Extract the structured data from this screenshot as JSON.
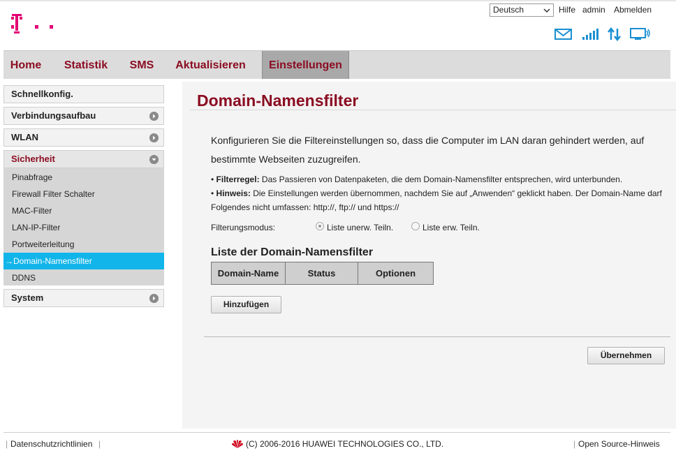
{
  "header": {
    "language": "Deutsch",
    "links": [
      "Hilfe",
      "admin",
      "Abmelden"
    ],
    "icons": [
      "mail-icon",
      "signal-icon",
      "data-transfer-icon",
      "monitor-icon"
    ],
    "brand_color": "#e20074"
  },
  "nav": {
    "tabs": [
      "Home",
      "Statistik",
      "SMS",
      "Aktualisieren",
      "Einstellungen"
    ],
    "active": "Einstellungen"
  },
  "sidebar": {
    "sections": [
      "Schnellkonfig.",
      "Verbindungsaufbau",
      "WLAN",
      "Sicherheit",
      "System"
    ],
    "open_section": "Sicherheit",
    "sub_items": [
      "Pinabfrage",
      "Firewall Filter Schalter",
      "MAC-Filter",
      "LAN-IP-Filter",
      "Portweiterleitung",
      "Domain-Namensfilter",
      "DDNS"
    ],
    "active_item": "Domain-Namensfilter",
    "active_prefix": "→"
  },
  "main": {
    "title": "Domain-Namensfilter",
    "intro": "Konfigurieren Sie die Filtereinstellungen so, dass die Computer im LAN daran gehindert werden, auf bestimmte Webseiten zuzugreifen.",
    "bullet1_label": "Filterregel:",
    "bullet1_text": " Das Passieren von Datenpaketen, die dem Domain-Namensfilter entsprechen, wird unterbunden.",
    "bullet2_label": "Hinweis:",
    "bullet2_text": " Die Einstellungen werden übernommen, nachdem Sie auf „Anwenden“ geklickt haben. Der Domain-Name darf Folgendes nicht umfassen: http://, ftp:// und https://",
    "filter_mode_label": "Filterungsmodus:",
    "radio_options": [
      "Liste unerw. Teiln.",
      "Liste erw. Teiln."
    ],
    "radio_selected": "Liste unerw. Teiln.",
    "list_title": "Liste der Domain-Namensfilter",
    "table_headers": [
      "Domain-Name",
      "Status",
      "Optionen"
    ],
    "add_button": "Hinzufügen",
    "apply_button": "Übernehmen"
  },
  "footer": {
    "privacy": "Datenschutzrichtlinien",
    "copyright": "(C) 2006-2016 HUAWEI TECHNOLOGIES CO., LTD.",
    "open_source": "Open Source-Hinweis"
  }
}
